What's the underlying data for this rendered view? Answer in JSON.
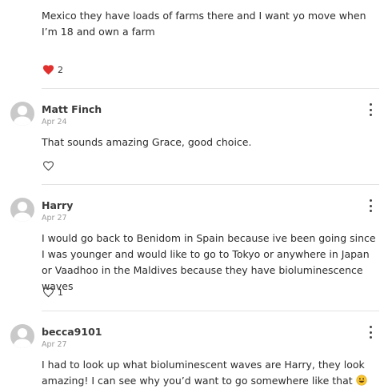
{
  "top_comment": {
    "text": "Mexico they have loads of farms there and I want yo move when I’m 18 and own a farm",
    "like_count": "2",
    "liked": true
  },
  "comments": [
    {
      "author": "Matt Finch",
      "date": "Apr 24",
      "text": "That sounds amazing Grace, good choice.",
      "like_count": ""
    },
    {
      "author": "Harry",
      "date": "Apr 27",
      "text": "I would go back to Benidom in Spain because ive been going since I was younger and would like to go to Tokyo or anywhere in Japan or Vaadhoo in the Maldives because they have bioluminescence waves",
      "like_count": "1"
    },
    {
      "author": "becca9101",
      "date": "Apr 27",
      "text": "I had to look up what bioluminescent waves are Harry, they look amazing! I can see why you’d want to go somewhere like that",
      "like_count": ""
    }
  ],
  "colors": {
    "heart_filled": "#e0312f",
    "avatar_bg": "#c9c9c9",
    "divider": "#e3e3e3"
  },
  "icons": [
    "heart-icon",
    "heart-outline-icon",
    "more-options-icon",
    "avatar-icon",
    "smile-emoji-icon"
  ]
}
